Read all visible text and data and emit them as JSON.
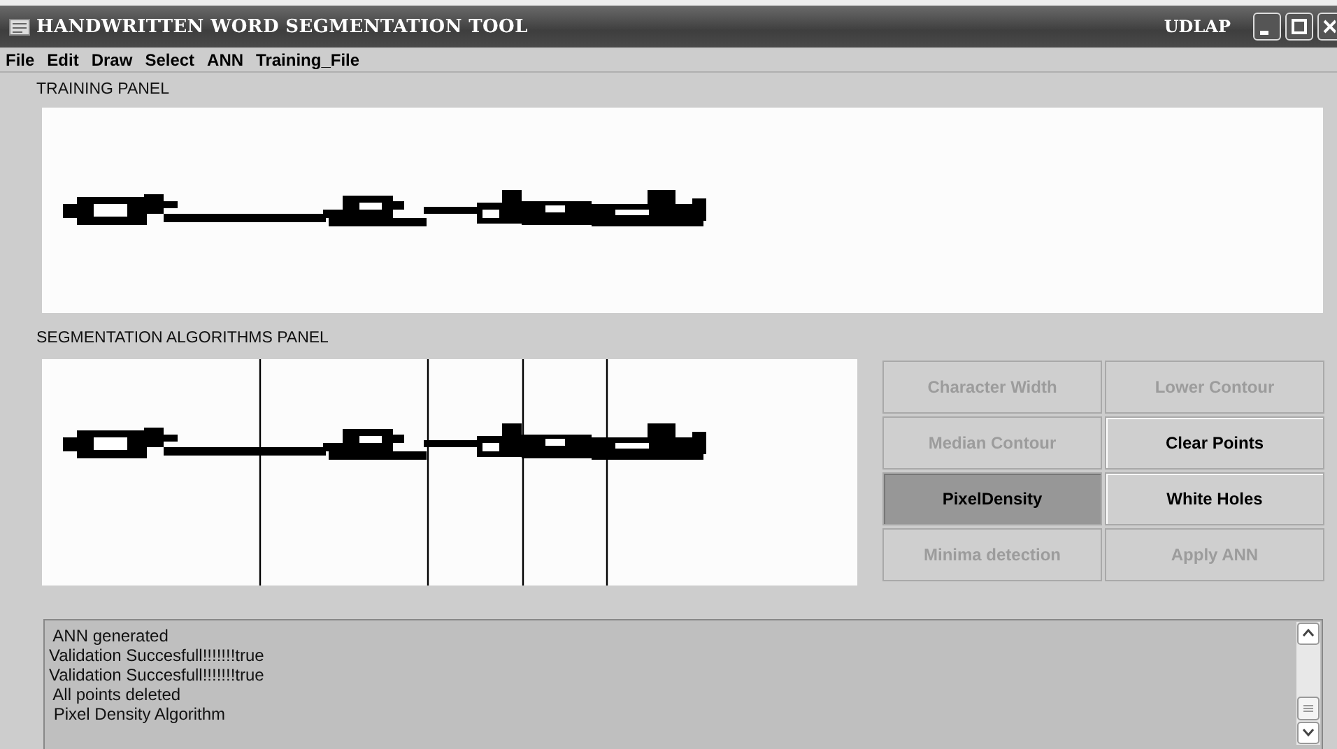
{
  "window": {
    "title": "HANDWRITTEN WORD SEGMENTATION TOOL",
    "tag": "UDLAP"
  },
  "menu": [
    "File",
    "Edit",
    "Draw",
    "Select",
    "ANN",
    "Training_File"
  ],
  "training_panel": {
    "label": "TRAINING PANEL"
  },
  "segmentation_panel": {
    "label": "SEGMENTATION ALGORITHMS PANEL"
  },
  "buttons": [
    {
      "label": "Character Width",
      "disabled": true,
      "selected": false
    },
    {
      "label": "Lower Contour",
      "disabled": true,
      "selected": false
    },
    {
      "label": "Median Contour",
      "disabled": true,
      "selected": false
    },
    {
      "label": "Clear Points",
      "disabled": false,
      "selected": false
    },
    {
      "label": "PixelDensity",
      "disabled": false,
      "selected": true
    },
    {
      "label": "White Holes",
      "disabled": false,
      "selected": false
    },
    {
      "label": "Minima detection",
      "disabled": true,
      "selected": false
    },
    {
      "label": "Apply ANN",
      "disabled": true,
      "selected": false
    }
  ],
  "log": [
    " ANN generated",
    "Validation Succesfull!!!!!!!true",
    "Validation Succesfull!!!!!!!true",
    " All points deleted",
    " Pixel Density Algorithm"
  ]
}
